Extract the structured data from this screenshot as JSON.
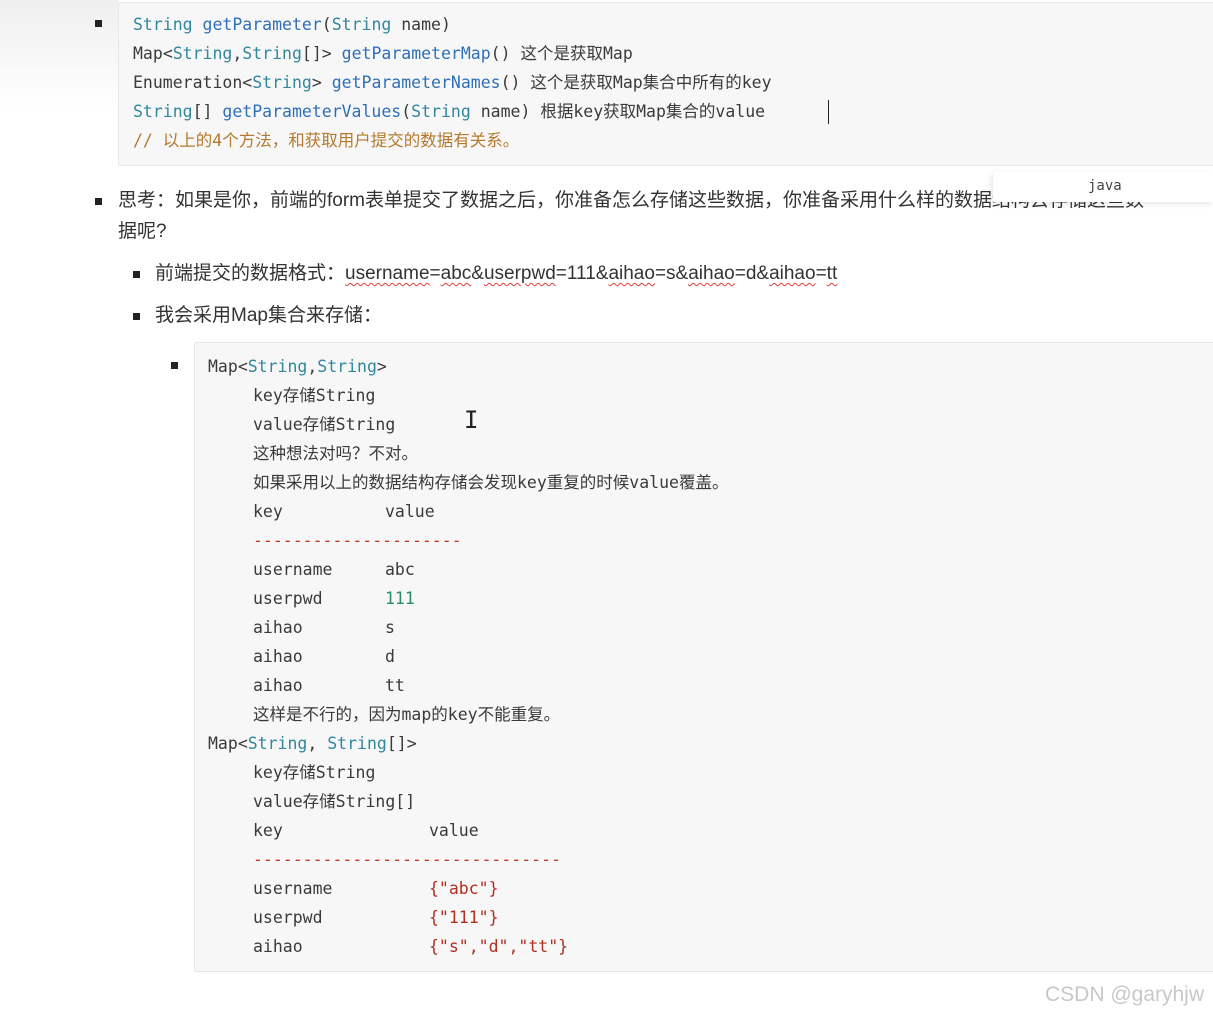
{
  "top_code": {
    "lines": [
      [
        "String",
        " ",
        "getParameter",
        "(",
        "String",
        " name)"
      ],
      [
        "Map",
        "<",
        "String",
        ",",
        "String",
        "[]>",
        " ",
        "getParameterMap",
        "()",
        " 这个是获取Map"
      ],
      [
        "Enumeration",
        "<",
        "String",
        ">",
        " ",
        "getParameterNames",
        "()",
        " 这个是获取Map集合中所有的key"
      ],
      [
        "String",
        "[] ",
        "getParameterValues",
        "(",
        "String",
        " name)",
        " 根据key获取Map集合的value"
      ],
      [
        "// 以上的4个方法，和获取用户提交的数据有关系。"
      ]
    ],
    "language_tag": "java"
  },
  "think": {
    "line1": "思考：如果是你，前端的form表单提交了数据之后，你准备怎么存储这些数据，你准备采用什么样的数据结构去存储这些数",
    "line2": "据呢?"
  },
  "format": {
    "label": "前端提交的数据格式：",
    "parts": [
      "username",
      "=",
      "abc",
      "&",
      "userpwd",
      "=111&",
      "aihao",
      "=s&",
      "aihao",
      "=d&",
      "aihao",
      "=",
      "tt"
    ]
  },
  "store_text": "我会采用Map集合来存储：",
  "map_block": {
    "map1_head": [
      "Map",
      "<",
      "String",
      ",",
      "String",
      ">"
    ],
    "map1_key": "key存储String",
    "map1_value": "value存储String",
    "map1_q": "这种想法对吗？不对。",
    "map1_note": "如果采用以上的数据结构存储会发现key重复的时候value覆盖。",
    "table1_header": [
      "key",
      "value"
    ],
    "table1_dashes": "---------------------",
    "table1_rows": [
      [
        "username",
        "abc"
      ],
      [
        "userpwd",
        "111"
      ],
      [
        "aihao",
        "s"
      ],
      [
        "aihao",
        "d"
      ],
      [
        "aihao",
        "tt"
      ]
    ],
    "map1_conclusion": "这样是不行的，因为map的key不能重复。",
    "map2_head": [
      "Map",
      "<",
      "String",
      ", ",
      "String",
      "[]>"
    ],
    "map2_key": "key存储String",
    "map2_value": "value存储String[]",
    "table2_header": [
      "key",
      "value"
    ],
    "table2_dashes": "-------------------------------",
    "table2_rows": [
      [
        "username",
        "{\"abc\"}"
      ],
      [
        "userpwd",
        "{\"111\"}"
      ],
      [
        "aihao",
        "{\"s\",\"d\",\"tt\"}"
      ]
    ]
  },
  "watermark": "CSDN @garyhjw",
  "colors": {
    "type": "#31879d",
    "method": "#2f6fb8",
    "comment": "#b57a2c",
    "string": "#b0301f",
    "squiggle": "#e23b3b"
  }
}
